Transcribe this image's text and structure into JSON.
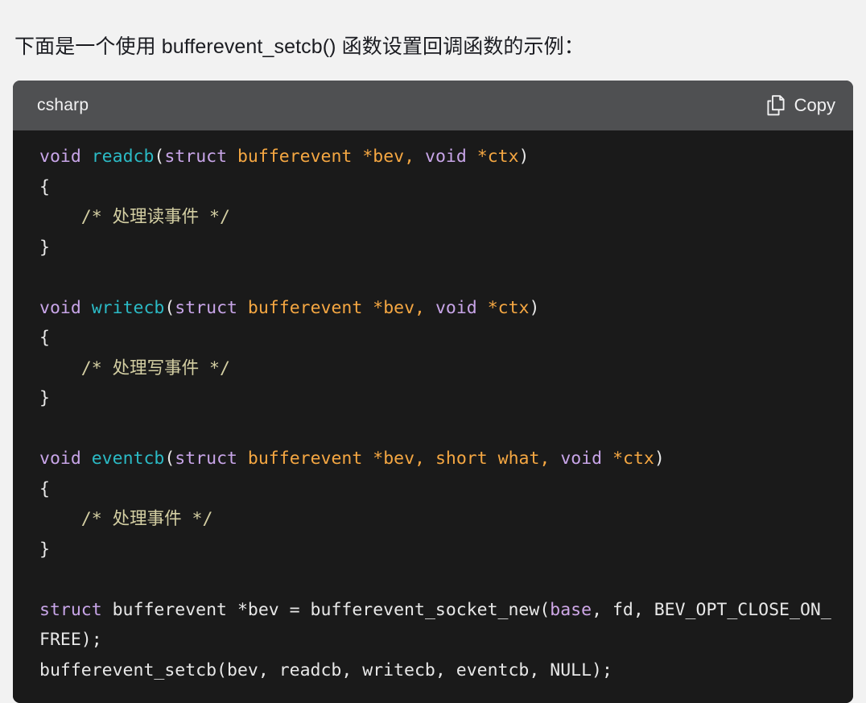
{
  "intro": {
    "text": "下面是一个使用 bufferevent_setcb() 函数设置回调函数的示例："
  },
  "code_block": {
    "language_label": "csharp",
    "copy_label": "Copy",
    "copy_icon": "copy-icon",
    "colors": {
      "page_background": "#f2f2f2",
      "header_background": "#4f5052",
      "body_background": "#1a1a1a",
      "keyword": "#c8a5e8",
      "function": "#2bbac5",
      "type": "#f5a742",
      "comment": "#d4cfa3",
      "plain": "#e8e8e8"
    },
    "lines": [
      {
        "id": "line-1",
        "tokens": [
          {
            "t": "void",
            "c": "kw"
          },
          {
            "t": " ",
            "c": "plain"
          },
          {
            "t": "readcb",
            "c": "fn"
          },
          {
            "t": "(",
            "c": "plain"
          },
          {
            "t": "struct",
            "c": "kw"
          },
          {
            "t": " ",
            "c": "plain"
          },
          {
            "t": "bufferevent",
            "c": "type"
          },
          {
            "t": " ",
            "c": "plain"
          },
          {
            "t": "*bev,",
            "c": "type"
          },
          {
            "t": " ",
            "c": "plain"
          },
          {
            "t": "void",
            "c": "kw"
          },
          {
            "t": " ",
            "c": "plain"
          },
          {
            "t": "*ctx",
            "c": "type"
          },
          {
            "t": ")",
            "c": "plain"
          }
        ]
      },
      {
        "id": "line-2",
        "tokens": [
          {
            "t": "{",
            "c": "plain"
          }
        ]
      },
      {
        "id": "line-3",
        "tokens": [
          {
            "t": "    /* 处理读事件 */",
            "c": "cmt"
          }
        ]
      },
      {
        "id": "line-4",
        "tokens": [
          {
            "t": "}",
            "c": "plain"
          }
        ]
      },
      {
        "id": "line-5",
        "tokens": [
          {
            "t": " ",
            "c": "plain"
          }
        ]
      },
      {
        "id": "line-6",
        "tokens": [
          {
            "t": "void",
            "c": "kw"
          },
          {
            "t": " ",
            "c": "plain"
          },
          {
            "t": "writecb",
            "c": "fn"
          },
          {
            "t": "(",
            "c": "plain"
          },
          {
            "t": "struct",
            "c": "kw"
          },
          {
            "t": " ",
            "c": "plain"
          },
          {
            "t": "bufferevent",
            "c": "type"
          },
          {
            "t": " ",
            "c": "plain"
          },
          {
            "t": "*bev,",
            "c": "type"
          },
          {
            "t": " ",
            "c": "plain"
          },
          {
            "t": "void",
            "c": "kw"
          },
          {
            "t": " ",
            "c": "plain"
          },
          {
            "t": "*ctx",
            "c": "type"
          },
          {
            "t": ")",
            "c": "plain"
          }
        ]
      },
      {
        "id": "line-7",
        "tokens": [
          {
            "t": "{",
            "c": "plain"
          }
        ]
      },
      {
        "id": "line-8",
        "tokens": [
          {
            "t": "    /* 处理写事件 */",
            "c": "cmt"
          }
        ]
      },
      {
        "id": "line-9",
        "tokens": [
          {
            "t": "}",
            "c": "plain"
          }
        ]
      },
      {
        "id": "line-10",
        "tokens": [
          {
            "t": " ",
            "c": "plain"
          }
        ]
      },
      {
        "id": "line-11",
        "tokens": [
          {
            "t": "void",
            "c": "kw"
          },
          {
            "t": " ",
            "c": "plain"
          },
          {
            "t": "eventcb",
            "c": "fn"
          },
          {
            "t": "(",
            "c": "plain"
          },
          {
            "t": "struct",
            "c": "kw"
          },
          {
            "t": " ",
            "c": "plain"
          },
          {
            "t": "bufferevent",
            "c": "type"
          },
          {
            "t": " ",
            "c": "plain"
          },
          {
            "t": "*bev,",
            "c": "type"
          },
          {
            "t": " ",
            "c": "plain"
          },
          {
            "t": "short",
            "c": "type"
          },
          {
            "t": " ",
            "c": "plain"
          },
          {
            "t": "what,",
            "c": "type"
          },
          {
            "t": " ",
            "c": "plain"
          },
          {
            "t": "void",
            "c": "kw"
          },
          {
            "t": " ",
            "c": "plain"
          },
          {
            "t": "*ctx",
            "c": "type"
          },
          {
            "t": ")",
            "c": "plain"
          }
        ]
      },
      {
        "id": "line-12",
        "tokens": [
          {
            "t": "{",
            "c": "plain"
          }
        ]
      },
      {
        "id": "line-13",
        "tokens": [
          {
            "t": "    /* 处理事件 */",
            "c": "cmt"
          }
        ]
      },
      {
        "id": "line-14",
        "tokens": [
          {
            "t": "}",
            "c": "plain"
          }
        ]
      },
      {
        "id": "line-15",
        "tokens": [
          {
            "t": " ",
            "c": "plain"
          }
        ]
      },
      {
        "id": "line-16",
        "tokens": [
          {
            "t": "struct",
            "c": "kw"
          },
          {
            "t": " bufferevent *bev = bufferevent_socket_new(",
            "c": "plain"
          },
          {
            "t": "base",
            "c": "var"
          },
          {
            "t": ", fd, BEV_OPT_CLOSE_ON_FREE);",
            "c": "plain"
          }
        ]
      },
      {
        "id": "line-17",
        "tokens": [
          {
            "t": "bufferevent_setcb(bev, readcb, writecb, eventcb, NULL);",
            "c": "plain"
          }
        ]
      }
    ]
  }
}
